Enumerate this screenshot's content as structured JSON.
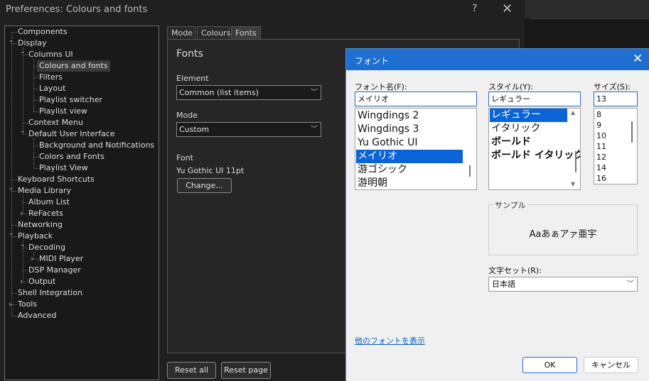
{
  "window": {
    "title": "Preferences: Colours and fonts",
    "help": "?",
    "close": "✕"
  },
  "tree": [
    {
      "label": "Components",
      "level": 0,
      "exp": ""
    },
    {
      "label": "Display",
      "level": 0,
      "exp": "open"
    },
    {
      "label": "Columns UI",
      "level": 1,
      "exp": "open"
    },
    {
      "label": "Colours and fonts",
      "level": 2,
      "exp": "",
      "selected": true
    },
    {
      "label": "Filters",
      "level": 2,
      "exp": ""
    },
    {
      "label": "Layout",
      "level": 2,
      "exp": ""
    },
    {
      "label": "Playlist switcher",
      "level": 2,
      "exp": ""
    },
    {
      "label": "Playlist view",
      "level": 2,
      "exp": ""
    },
    {
      "label": "Context Menu",
      "level": 1,
      "exp": ""
    },
    {
      "label": "Default User Interface",
      "level": 1,
      "exp": "open"
    },
    {
      "label": "Background and Notifications",
      "level": 2,
      "exp": ""
    },
    {
      "label": "Colors and Fonts",
      "level": 2,
      "exp": ""
    },
    {
      "label": "Playlist View",
      "level": 2,
      "exp": ""
    },
    {
      "label": "Keyboard Shortcuts",
      "level": 0,
      "exp": ""
    },
    {
      "label": "Media Library",
      "level": 0,
      "exp": "open"
    },
    {
      "label": "Album List",
      "level": 1,
      "exp": ""
    },
    {
      "label": "ReFacets",
      "level": 1,
      "exp": "closed"
    },
    {
      "label": "Networking",
      "level": 0,
      "exp": ""
    },
    {
      "label": "Playback",
      "level": 0,
      "exp": "open"
    },
    {
      "label": "Decoding",
      "level": 1,
      "exp": "open"
    },
    {
      "label": "MIDI Player",
      "level": 2,
      "exp": "closed"
    },
    {
      "label": "DSP Manager",
      "level": 1,
      "exp": ""
    },
    {
      "label": "Output",
      "level": 1,
      "exp": "closed"
    },
    {
      "label": "Shell Integration",
      "level": 0,
      "exp": ""
    },
    {
      "label": "Tools",
      "level": 0,
      "exp": "closed"
    },
    {
      "label": "Advanced",
      "level": 0,
      "exp": ""
    }
  ],
  "tabs": [
    "Mode",
    "Colours",
    "Fonts"
  ],
  "panel": {
    "heading": "Fonts",
    "element_label": "Element",
    "element_value": "Common (list items)",
    "mode_label": "Mode",
    "mode_value": "Custom",
    "font_label": "Font",
    "font_value": "Yu Gothic UI 11pt",
    "change_button": "Change..."
  },
  "buttons": {
    "reset_all": "Reset all",
    "reset_page": "Reset page"
  },
  "dialog": {
    "title": "フォント",
    "close": "✕",
    "font_name_label": "フォント名(F):",
    "font_name_value": "メイリオ",
    "style_label": "スタイル(Y):",
    "style_value": "レギュラー",
    "size_label": "サイズ(S):",
    "size_value": "13",
    "font_list": [
      "Wingdings 2",
      "Wingdings 3",
      "Yu Gothic UI",
      "メイリオ",
      "游ゴシック",
      "游明朝"
    ],
    "font_selected": 3,
    "style_list": [
      "レギュラー",
      "イタリック",
      "ボールド",
      "ボールド イタリック"
    ],
    "style_selected": 0,
    "size_list": [
      "8",
      "9",
      "10",
      "11",
      "12",
      "14",
      "16"
    ],
    "sample_label": "サンプル",
    "sample_text": "Aaあぁアァ亜宇",
    "charset_label": "文字セット(R):",
    "charset_value": "日本語",
    "more_fonts_link": "他のフォントを表示",
    "ok": "OK",
    "cancel": "キャンセル"
  }
}
